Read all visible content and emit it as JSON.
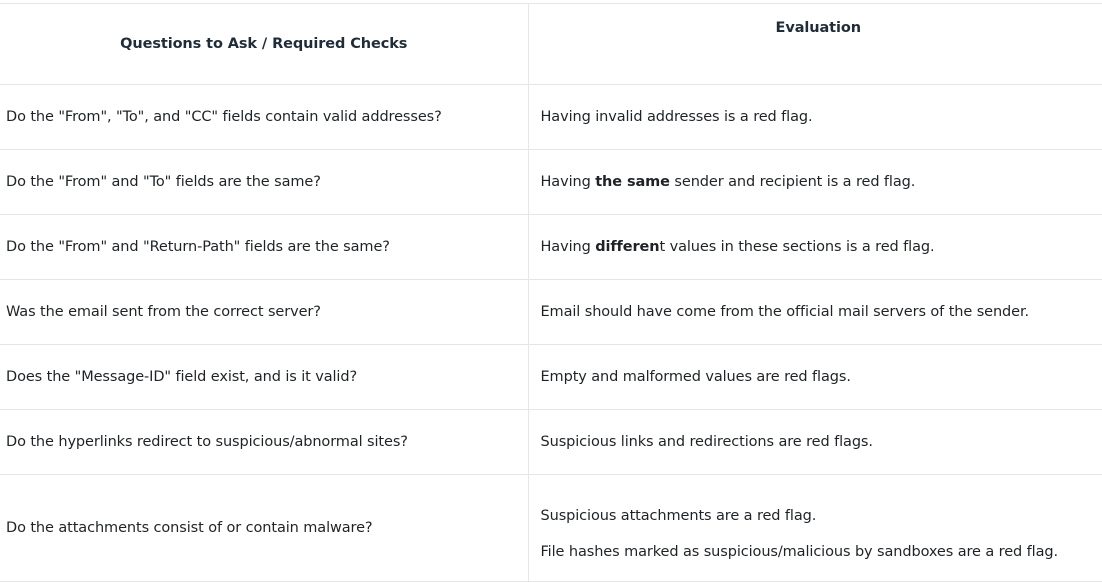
{
  "table": {
    "headers": {
      "question": "Questions to Ask / Required Checks",
      "evaluation": "Evaluation"
    },
    "rows": [
      {
        "question": "Do the \"From\", \"To\", and \"CC\" fields contain valid addresses?",
        "evaluation": "Having invalid addresses is a red flag."
      },
      {
        "question": "Do the \"From\" and \"To\" fields are the same?",
        "evaluation_pre": "Having ",
        "evaluation_bold": "the same",
        "evaluation_post": " sender and recipient is a red flag."
      },
      {
        "question": "Do the \"From\" and \"Return-Path\" fields are the same?",
        "evaluation_pre": "Having ",
        "evaluation_bold": "differen",
        "evaluation_post": "t values in these sections is a red flag."
      },
      {
        "question": "Was the email sent from the correct server?",
        "evaluation": "Email should have come from the official mail servers of the sender."
      },
      {
        "question": "Does the \"Message-ID\" field exist, and is it valid?",
        "evaluation": "Empty and malformed values are red flags."
      },
      {
        "question": "Do the hyperlinks redirect to suspicious/abnormal sites?",
        "evaluation": "Suspicious links and redirections are red flags."
      },
      {
        "question": "Do the attachments consist of or contain malware?",
        "evaluation_lines": [
          "Suspicious attachments are a red flag.",
          "File hashes marked as suspicious/malicious by sandboxes are a red flag."
        ]
      }
    ]
  }
}
